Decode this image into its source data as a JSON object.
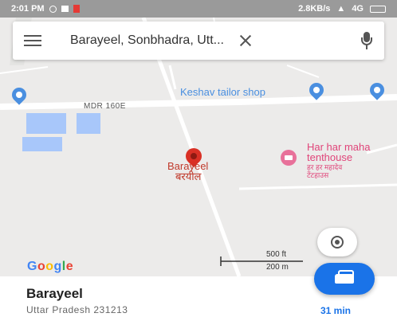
{
  "status_bar": {
    "time": "2:01 PM",
    "network": "2.8KB/s",
    "signal": "4G"
  },
  "search": {
    "query": "Barayeel, Sonbhadra, Utt..."
  },
  "map": {
    "road_name": "MDR 160E",
    "shop_label": "Keshav tailor shop",
    "place_name_en": "Barayeel",
    "place_name_hi": "बरयील",
    "poi_name_line1": "Har har maha",
    "poi_name_line2": "tenthouse",
    "poi_sub_line1": "हर हर महादेव",
    "poi_sub_line2": "टेंटहाउस",
    "scale_ft": "500 ft",
    "scale_m": "200 m",
    "logo_letters": [
      "G",
      "o",
      "o",
      "g",
      "l",
      "e"
    ],
    "logo_colors": [
      "#4285f4",
      "#ea4335",
      "#fbbc05",
      "#4285f4",
      "#34a853",
      "#ea4335"
    ]
  },
  "place_sheet": {
    "title": "Barayeel",
    "subtitle": "Uttar Pradesh 231213",
    "travel_time": "31 min"
  },
  "colors": {
    "accent": "#1a73e8",
    "pin_red": "#d93025",
    "poi_blue": "#4a8fe0",
    "poi_pink": "#e0457a"
  }
}
